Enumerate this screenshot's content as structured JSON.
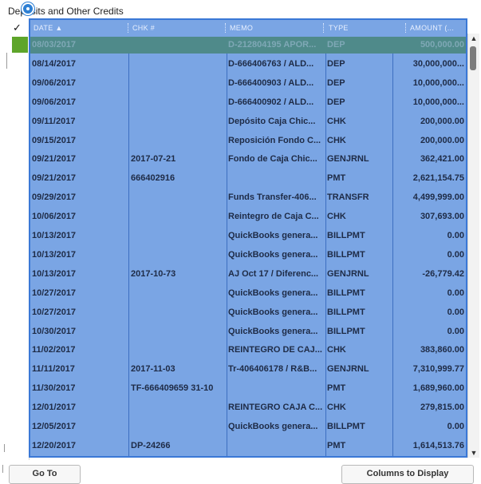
{
  "section": {
    "title": "Deposits and Other Credits"
  },
  "check_column": {
    "header": "✓"
  },
  "grid": {
    "columns": [
      {
        "key": "date",
        "label": "DATE ▲"
      },
      {
        "key": "chk",
        "label": "CHK #"
      },
      {
        "key": "memo",
        "label": "MEMO"
      },
      {
        "key": "type",
        "label": "TYPE"
      },
      {
        "key": "amount",
        "label": "AMOUNT (..."
      }
    ],
    "rows": [
      {
        "date": "08/03/2017",
        "chk": "",
        "memo": "D-212804195 APOR...",
        "type": "DEP",
        "amount": "500,000.00",
        "selected": true
      },
      {
        "date": "08/14/2017",
        "chk": "",
        "memo": "D-666406763 / ALD...",
        "type": "DEP",
        "amount": "30,000,000..."
      },
      {
        "date": "09/06/2017",
        "chk": "",
        "memo": "D-666400903 / ALD...",
        "type": "DEP",
        "amount": "10,000,000..."
      },
      {
        "date": "09/06/2017",
        "chk": "",
        "memo": "D-666400902 / ALD...",
        "type": "DEP",
        "amount": "10,000,000..."
      },
      {
        "date": "09/11/2017",
        "chk": "",
        "memo": "Depósito Caja Chic...",
        "type": "CHK",
        "amount": "200,000.00"
      },
      {
        "date": "09/15/2017",
        "chk": "",
        "memo": "Reposición Fondo C...",
        "type": "CHK",
        "amount": "200,000.00"
      },
      {
        "date": "09/21/2017",
        "chk": "2017-07-21",
        "memo": "Fondo de Caja Chic...",
        "type": "GENJRNL",
        "amount": "362,421.00"
      },
      {
        "date": "09/21/2017",
        "chk": "666402916",
        "memo": "",
        "type": "PMT",
        "amount": "2,621,154.75"
      },
      {
        "date": "09/29/2017",
        "chk": "",
        "memo": "Funds Transfer-406...",
        "type": "TRANSFR",
        "amount": "4,499,999.00"
      },
      {
        "date": "10/06/2017",
        "chk": "",
        "memo": "Reintegro de Caja C...",
        "type": "CHK",
        "amount": "307,693.00"
      },
      {
        "date": "10/13/2017",
        "chk": "",
        "memo": "QuickBooks genera...",
        "type": "BILLPMT",
        "amount": "0.00"
      },
      {
        "date": "10/13/2017",
        "chk": "",
        "memo": "QuickBooks genera...",
        "type": "BILLPMT",
        "amount": "0.00"
      },
      {
        "date": "10/13/2017",
        "chk": "2017-10-73",
        "memo": "AJ Oct 17 / Diferenc...",
        "type": "GENJRNL",
        "amount": "-26,779.42"
      },
      {
        "date": "10/27/2017",
        "chk": "",
        "memo": "QuickBooks genera...",
        "type": "BILLPMT",
        "amount": "0.00"
      },
      {
        "date": "10/27/2017",
        "chk": "",
        "memo": "QuickBooks genera...",
        "type": "BILLPMT",
        "amount": "0.00"
      },
      {
        "date": "10/30/2017",
        "chk": "",
        "memo": "QuickBooks genera...",
        "type": "BILLPMT",
        "amount": "0.00"
      },
      {
        "date": "11/02/2017",
        "chk": "",
        "memo": "REINTEGRO DE CAJ...",
        "type": "CHK",
        "amount": "383,860.00"
      },
      {
        "date": "11/11/2017",
        "chk": "2017-11-03",
        "memo": "Tr-406406178 / R&B...",
        "type": "GENJRNL",
        "amount": "7,310,999.77"
      },
      {
        "date": "11/30/2017",
        "chk": "TF-666409659 31-10",
        "memo": "",
        "type": "PMT",
        "amount": "1,689,960.00"
      },
      {
        "date": "12/01/2017",
        "chk": "",
        "memo": "REINTEGRO CAJA C...",
        "type": "CHK",
        "amount": "279,815.00"
      },
      {
        "date": "12/05/2017",
        "chk": "",
        "memo": "QuickBooks genera...",
        "type": "BILLPMT",
        "amount": "0.00"
      },
      {
        "date": "12/20/2017",
        "chk": "DP-24266",
        "memo": "",
        "type": "PMT",
        "amount": "1,614,513.76"
      }
    ]
  },
  "scrollbar": {
    "up": "▲",
    "down": "▼"
  },
  "buttons": {
    "goto": "Go To",
    "columns": "Columns to Display"
  },
  "colors": {
    "grid_bg": "#7aa5e4",
    "grid_border": "#3a78d6",
    "selected_row": "#4f8a8a",
    "check_mark": "#5ea52a"
  }
}
